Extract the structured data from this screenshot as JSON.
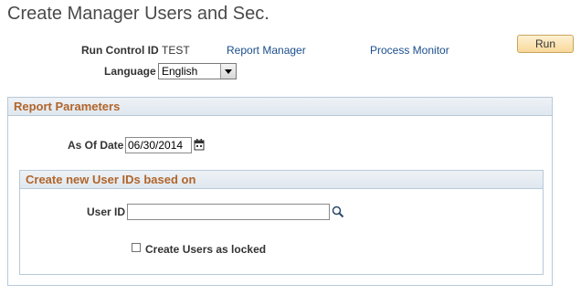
{
  "page": {
    "title": "Create Manager Users and Sec."
  },
  "header": {
    "run_control_label": "Run Control ID",
    "run_control_value": "TEST",
    "report_manager_link": "Report Manager",
    "process_monitor_link": "Process Monitor",
    "run_button": "Run",
    "language_label": "Language",
    "language_value": "English"
  },
  "report_parameters": {
    "title": "Report Parameters",
    "as_of_date_label": "As Of Date",
    "as_of_date_value": "06/30/2014",
    "user_ids_section": {
      "title": "Create new User IDs based on",
      "user_id_label": "User ID",
      "user_id_value": "",
      "create_locked_label": "Create Users as locked",
      "create_locked_checked": false
    }
  },
  "icons": {
    "calendar": "calendar-icon",
    "lookup": "magnifier-icon",
    "dropdown": "chevron-down-icon"
  },
  "colors": {
    "section_title": "#b1652a",
    "link": "#1a4e8c",
    "group_border": "#b9c9d8",
    "button_fill": "#f8d89a"
  }
}
